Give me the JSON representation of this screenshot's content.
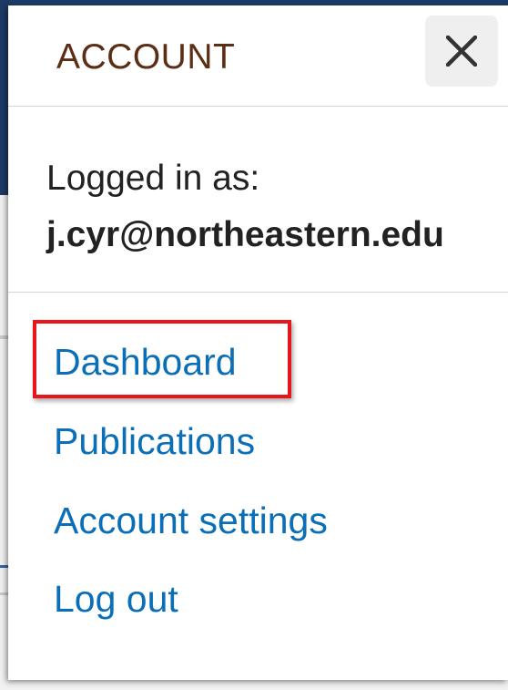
{
  "panel": {
    "title": "ACCOUNT",
    "close_icon": "close-icon"
  },
  "user": {
    "logged_in_label": "Logged in as:",
    "email": "j.cyr@northeastern.edu"
  },
  "menu": {
    "items": [
      {
        "label": "Dashboard",
        "highlighted": true
      },
      {
        "label": "Publications"
      },
      {
        "label": "Account settings"
      },
      {
        "label": "Log out"
      }
    ]
  },
  "colors": {
    "title": "#5b2f16",
    "link": "#0b6fb8",
    "highlight": "#e8161a"
  }
}
